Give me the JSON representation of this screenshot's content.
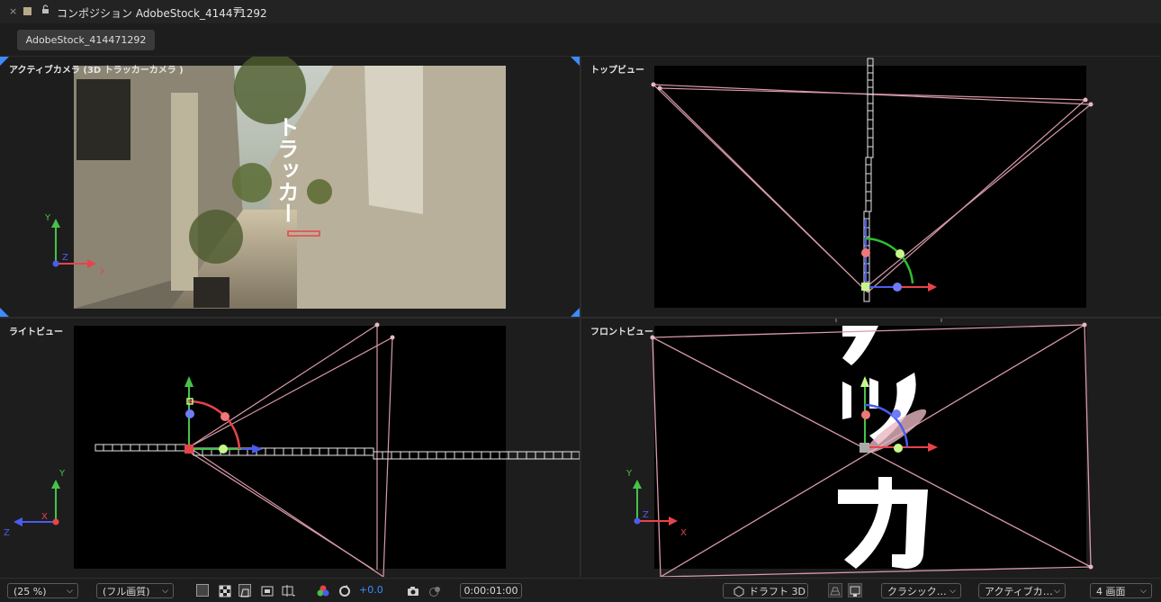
{
  "window": {
    "close_glyph": "×",
    "title": "コンポジション AdobeStock_414471292",
    "menu_glyph": "≡"
  },
  "tab": {
    "label": "AdobeStock_414471292"
  },
  "viewports": {
    "active_camera": {
      "label": "アクティブカメラ (3D トラッカーカメラ )",
      "overlay_text": "トラッカー"
    },
    "top_view": {
      "label": "トップビュー"
    },
    "right_view": {
      "label": "ライトビュー"
    },
    "front_view": {
      "label": "フロントビュー"
    }
  },
  "axes": {
    "x": "X",
    "y": "Y",
    "z": "Z"
  },
  "status_bar": {
    "zoom": "(25 %)",
    "resolution": "(フル画質)",
    "exposure": "+0.0",
    "timecode": "0:00:01:00",
    "draft_3d": "ドラフト 3D",
    "renderer": "クラシック…",
    "camera": "アクティブカ…",
    "layout": "4 画面"
  },
  "colors": {
    "axis_x": "#e8434a",
    "axis_y": "#46c24a",
    "axis_z": "#4a5cf0",
    "frame_lines": "#d89aa8",
    "accent_blue": "#3d8bff"
  }
}
